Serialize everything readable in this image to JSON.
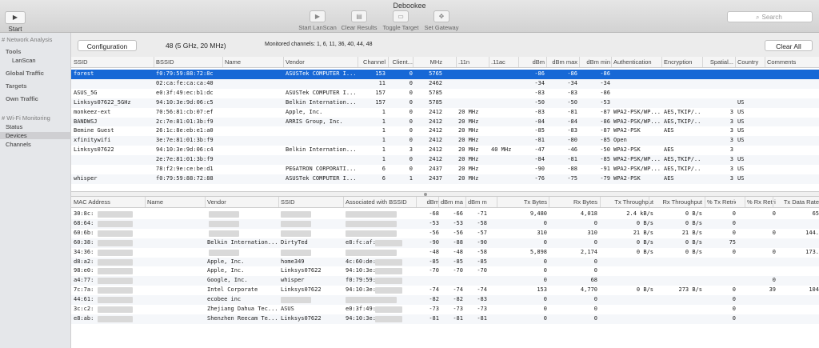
{
  "window": {
    "title": "Debookee"
  },
  "toolbar": {
    "start_wm": "Start WM",
    "start_lanscan": "Start LanScan",
    "clear_results": "Clear Results",
    "toggle_target": "Toggle Target",
    "set_gateway": "Set Gateway",
    "search_placeholder": "Search"
  },
  "sidebar": {
    "network_analysis": "# Network Analysis",
    "tools": "Tools",
    "lanscan": "LanScan",
    "global_traffic": "Global Traffic",
    "targets": "Targets",
    "own_traffic": "Own Traffic",
    "wifi_monitoring": "# Wi-Fi Monitoring",
    "status": "Status",
    "devices": "Devices",
    "channels": "Channels"
  },
  "controls": {
    "configuration": "Configuration",
    "channel": "48 (5 GHz, 20 MHz)",
    "monitored": "Monitored channels:  1, 6, 11, 36, 40, 44, 48",
    "clear_all": "Clear All"
  },
  "ap_table": {
    "columns": [
      "SSID",
      "BSSID",
      "Name",
      "Vendor",
      "Channel",
      "Client...",
      "MHz",
      ".11n",
      ".11ac",
      "dBm",
      "dBm max",
      "dBm min",
      "Authentication",
      "Encryption",
      "Spatial...",
      "Country",
      "Comments"
    ],
    "rows": [
      [
        "forest",
        "f0:79:59:88:72:8c",
        "",
        "ASUSTek COMPUTER I...",
        "153",
        "0",
        "5765",
        "",
        "",
        "-86",
        "-86",
        "-86",
        "",
        "",
        "",
        "",
        ""
      ],
      [
        "",
        "02:ca:fe:ca:ca:40",
        "",
        "",
        "11",
        "0",
        "2462",
        "",
        "",
        "-34",
        "-34",
        "-34",
        "",
        "",
        "",
        "",
        ""
      ],
      [
        "ASUS_5G",
        "e0:3f:49:ec:b1:dc",
        "",
        "ASUSTek COMPUTER I...",
        "157",
        "0",
        "5785",
        "",
        "",
        "-83",
        "-83",
        "-86",
        "",
        "",
        "",
        "",
        ""
      ],
      [
        "Linksys07622_5GHz",
        "94:10:3e:9d:06:c5",
        "",
        "Belkin Internation...",
        "157",
        "0",
        "5785",
        "",
        "",
        "-50",
        "-50",
        "-53",
        "",
        "",
        "",
        "US",
        ""
      ],
      [
        "monkeez-ext",
        "70:56:81:cb:07:ef",
        "",
        "Apple, Inc.",
        "1",
        "0",
        "2412",
        "20 MHz",
        "",
        "-83",
        "-81",
        "-87",
        "WPA2-PSK/WP...",
        "AES,TKIP/...",
        "3",
        "US",
        ""
      ],
      [
        "BANDWSJ",
        "2c:7e:81:01:3b:f9",
        "",
        "ARRIS Group, Inc.",
        "1",
        "0",
        "2412",
        "20 MHz",
        "",
        "-84",
        "-84",
        "-86",
        "WPA2-PSK/WP...",
        "AES,TKIP/...",
        "3",
        "US",
        ""
      ],
      [
        "Bemine Guest",
        "26:1c:8e:eb:e1:a0",
        "",
        "",
        "1",
        "0",
        "2412",
        "20 MHz",
        "",
        "-85",
        "-83",
        "-87",
        "WPA2-PSK",
        "AES",
        "3",
        "US",
        ""
      ],
      [
        "xfinitywifi",
        "3e:7e:81:01:3b:f9",
        "",
        "",
        "1",
        "0",
        "2412",
        "20 MHz",
        "",
        "-81",
        "-80",
        "-85",
        "Open",
        "",
        "3",
        "US",
        ""
      ],
      [
        "Linksys07622",
        "94:10:3e:9d:06:c4",
        "",
        "Belkin Internation...",
        "1",
        "3",
        "2412",
        "20 MHz",
        "40 MHz",
        "-47",
        "-46",
        "-50",
        "WPA2-PSK",
        "AES",
        "3",
        "",
        ""
      ],
      [
        "",
        "2e:7e:81:01:3b:f9",
        "",
        "",
        "1",
        "0",
        "2412",
        "20 MHz",
        "",
        "-84",
        "-81",
        "-85",
        "WPA2-PSK/WP...",
        "AES,TKIP/...",
        "3",
        "US",
        ""
      ],
      [
        "",
        "78:f2:9e:ce:be:d1",
        "",
        "PEGATRON CORPORATI...",
        "6",
        "0",
        "2437",
        "20 MHz",
        "",
        "-90",
        "-88",
        "-91",
        "WPA2-PSK/WP...",
        "AES,TKIP/...",
        "3",
        "US",
        ""
      ],
      [
        "whisper",
        "f0:79:59:88:72:88",
        "",
        "ASUSTek COMPUTER I...",
        "6",
        "1",
        "2437",
        "20 MHz",
        "",
        "-76",
        "-75",
        "-79",
        "WPA2-PSK",
        "AES",
        "3",
        "US",
        ""
      ]
    ]
  },
  "client_table": {
    "columns": [
      "MAC Address",
      "Name",
      "Vendor",
      "SSID",
      "Associated with BSSID",
      "dBm",
      "dBm max",
      "dBm min",
      "Tx Bytes",
      "Rx Bytes",
      "Tx Throughput",
      "Rx Throughput",
      "% Tx Retries",
      "% Rx Retries",
      "Tx Data Rate"
    ],
    "rows": [
      [
        "30:8c:",
        "",
        "",
        "",
        "",
        "-68",
        "-66",
        "-71",
        "9,480",
        "4,018",
        "2.4 kB/s",
        "0 B/s",
        "0",
        "0",
        "65"
      ],
      [
        "68:64:",
        "",
        "",
        "",
        "",
        "-53",
        "-53",
        "-58",
        "0",
        "0",
        "0 B/s",
        "0 B/s",
        "0",
        "",
        ""
      ],
      [
        "60:6b:",
        "",
        "",
        "",
        "",
        "-56",
        "-56",
        "-57",
        "310",
        "310",
        "21 B/s",
        "21 B/s",
        "0",
        "0",
        "144."
      ],
      [
        "60:38:",
        "",
        "Belkin Internation...",
        "DirtyTed",
        "e8:fc:af:",
        "-90",
        "-88",
        "-90",
        "0",
        "0",
        "0 B/s",
        "0 B/s",
        "75",
        "",
        ""
      ],
      [
        "34:36:",
        "",
        "",
        "",
        "",
        "-48",
        "-48",
        "-58",
        "5,898",
        "2,174",
        "0 B/s",
        "0 B/s",
        "0",
        "0",
        "173."
      ],
      [
        "d8:a2:",
        "",
        "Apple, Inc.",
        "home349",
        "4c:60:de:",
        "-85",
        "-85",
        "-85",
        "0",
        "0",
        "",
        "",
        "",
        "",
        ""
      ],
      [
        "98:e0:",
        "",
        "Apple, Inc.",
        "Linksys07622",
        "94:10:3e:",
        "-70",
        "-70",
        "-70",
        "0",
        "0",
        "",
        "",
        "",
        "",
        ""
      ],
      [
        "a4:77:",
        "",
        "Google, Inc.",
        "whisper",
        "f0:79:59:",
        "",
        "",
        "",
        "0",
        "68",
        "",
        "",
        "",
        "0",
        ""
      ],
      [
        "7c:7a:",
        "",
        "Intel Corporate",
        "Linksys07622",
        "94:10:3e:",
        "-74",
        "-74",
        "-74",
        "153",
        "4,770",
        "0 B/s",
        "273 B/s",
        "0",
        "39",
        "104"
      ],
      [
        "44:61:",
        "",
        "ecobee inc",
        "",
        "",
        "-82",
        "-82",
        "-83",
        "0",
        "0",
        "",
        "",
        "0",
        "",
        ""
      ],
      [
        "3c:c2:",
        "",
        "Zhejiang Dahua Tec...",
        "ASUS",
        "e0:3f:49:",
        "-73",
        "-73",
        "-73",
        "0",
        "0",
        "",
        "",
        "0",
        "",
        ""
      ],
      [
        "e8:ab:",
        "",
        "Shenzhen Reecam Te...",
        "Linksys07622",
        "94:10:3e:",
        "-81",
        "-81",
        "-81",
        "0",
        "0",
        "",
        "",
        "0",
        "",
        ""
      ]
    ]
  }
}
